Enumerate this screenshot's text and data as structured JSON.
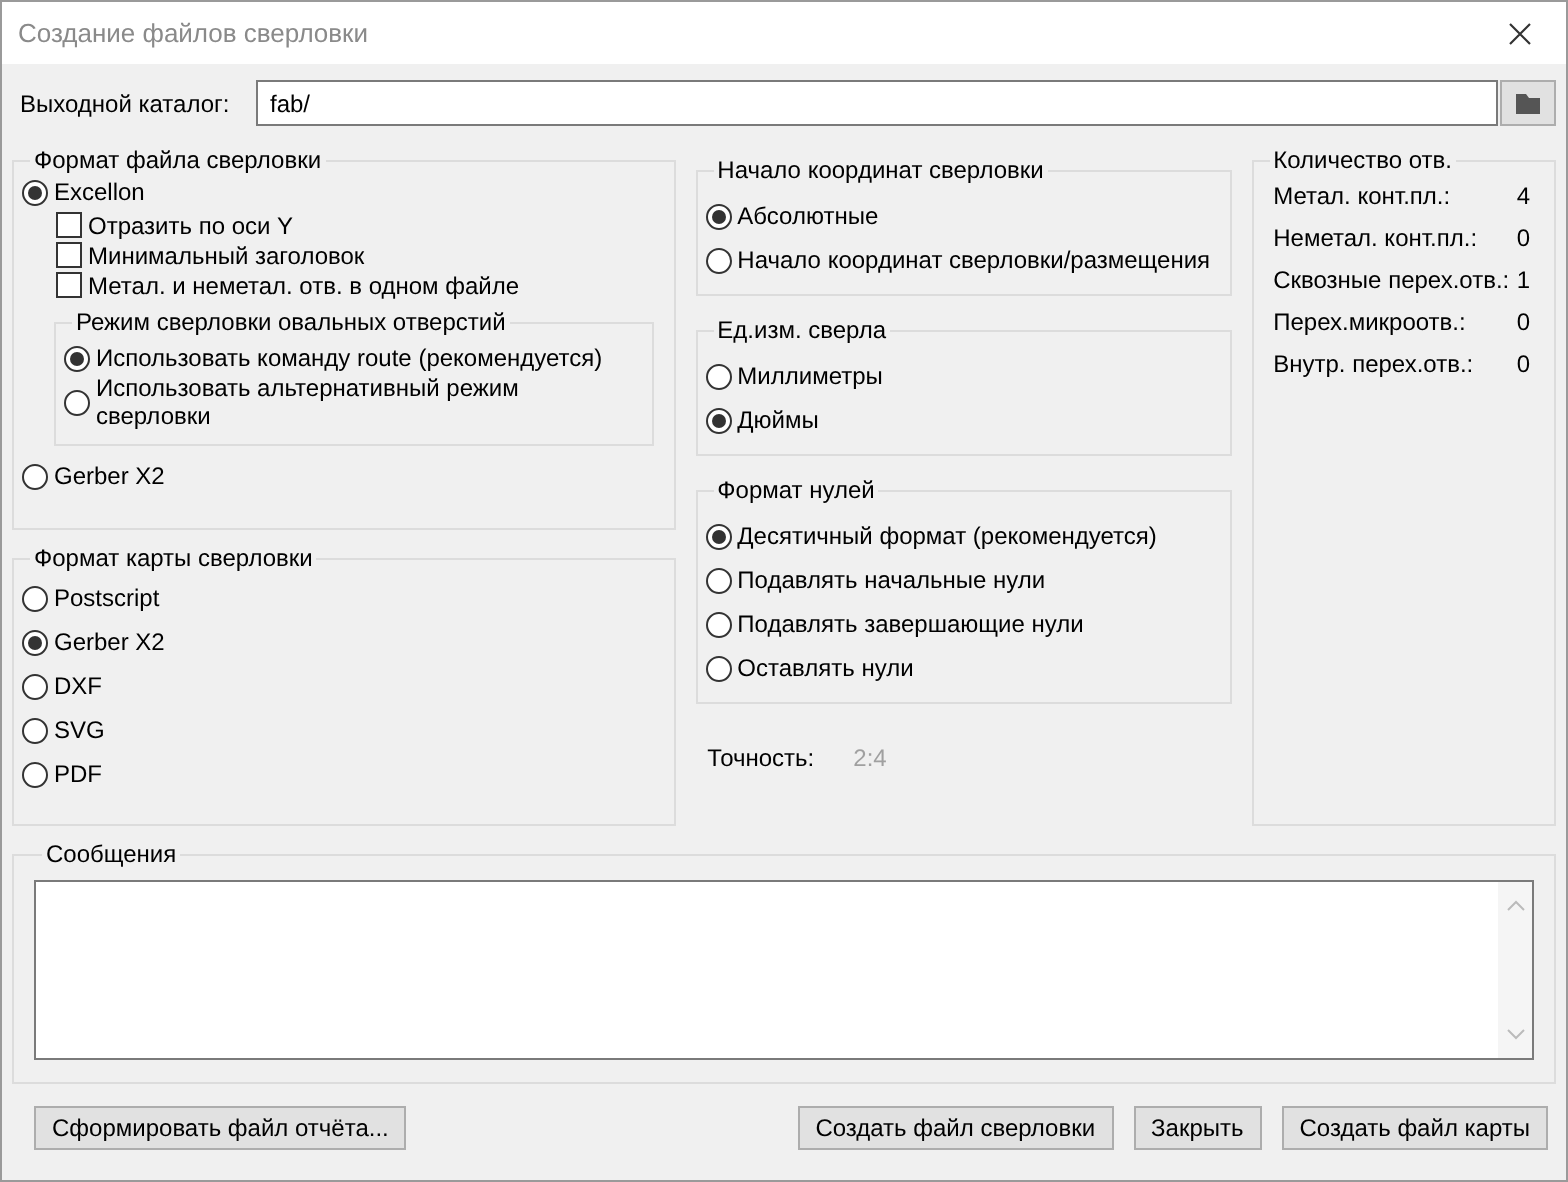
{
  "window": {
    "title": "Создание файлов сверловки"
  },
  "output_dir": {
    "label": "Выходной каталог:",
    "value": "fab/"
  },
  "drill_file_format": {
    "title": "Формат файла сверловки",
    "formats": [
      {
        "label": "Excellon",
        "selected": true,
        "checkboxes": [
          {
            "label": "Отразить по оси Y",
            "checked": false
          },
          {
            "label": "Минимальный заголовок",
            "checked": false
          },
          {
            "label": "Метал. и неметал. отв. в одном файле",
            "checked": false
          }
        ],
        "oval_mode": {
          "title": "Режим сверловки овальных отверстий",
          "options": [
            {
              "label": "Использовать команду route (рекомендуется)",
              "selected": true
            },
            {
              "label": "Использовать альтернативный режим сверловки",
              "selected": false
            }
          ]
        }
      },
      {
        "label": "Gerber X2",
        "selected": false
      }
    ]
  },
  "map_format": {
    "title": "Формат карты сверловки",
    "options": [
      {
        "label": "Postscript",
        "selected": false
      },
      {
        "label": "Gerber X2",
        "selected": true
      },
      {
        "label": "DXF",
        "selected": false
      },
      {
        "label": "SVG",
        "selected": false
      },
      {
        "label": "PDF",
        "selected": false
      }
    ]
  },
  "origin": {
    "title": "Начало координат сверловки",
    "options": [
      {
        "label": "Абсолютные",
        "selected": true
      },
      {
        "label": "Начало координат сверловки/размещения",
        "selected": false
      }
    ]
  },
  "units": {
    "title": "Ед.изм. сверла",
    "options": [
      {
        "label": "Миллиметры",
        "selected": false
      },
      {
        "label": "Дюймы",
        "selected": true
      }
    ]
  },
  "zeros": {
    "title": "Формат нулей",
    "options": [
      {
        "label": "Десятичный формат (рекомендуется)",
        "selected": true
      },
      {
        "label": "Подавлять начальные нули",
        "selected": false
      },
      {
        "label": "Подавлять завершающие нули",
        "selected": false
      },
      {
        "label": "Оставлять нули",
        "selected": false
      }
    ]
  },
  "precision": {
    "label": "Точность:",
    "value": "2:4"
  },
  "hole_counts": {
    "title": "Количество отв.",
    "rows": [
      {
        "label": "Метал. конт.пл.:",
        "value": "4"
      },
      {
        "label": "Неметал. конт.пл.:",
        "value": "0"
      },
      {
        "label": "Сквозные перех.отв.:",
        "value": "1"
      },
      {
        "label": "Перех.микроотв.:",
        "value": "0"
      },
      {
        "label": "Внутр. перех.отв.:",
        "value": "0"
      }
    ]
  },
  "messages": {
    "title": "Сообщения"
  },
  "report_button": "Сформировать файл отчёта...",
  "buttons": [
    "Создать файл сверловки",
    "Закрыть",
    "Создать файл карты"
  ]
}
